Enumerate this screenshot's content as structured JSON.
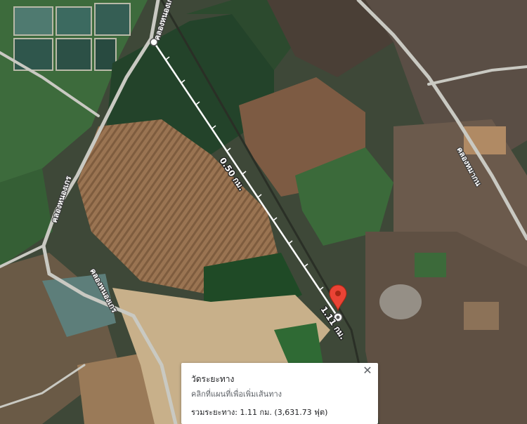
{
  "map": {
    "road_labels": [
      "คลองหนองเกร",
      "คลองหนองเกร",
      "คลองหนองเกร",
      "คลองหมากน"
    ],
    "segment_label": "0.50 กม.",
    "end_label": "1.11 กม.",
    "colors": {
      "route_line": "#ffffff",
      "pin": "#ea4335",
      "field_green": "#2e4d2a",
      "field_brown": "#8a6a4a",
      "road": "#c7c7c0"
    }
  },
  "panel": {
    "title": "วัดระยะทาง",
    "hint": "คลิกที่แผนที่เพื่อเพิ่มเส้นทาง",
    "total_label": "รวมระยะทาง:",
    "total_value": "1.11 กม. (3,631.73 ฟุต)",
    "close_icon": "close-icon"
  }
}
